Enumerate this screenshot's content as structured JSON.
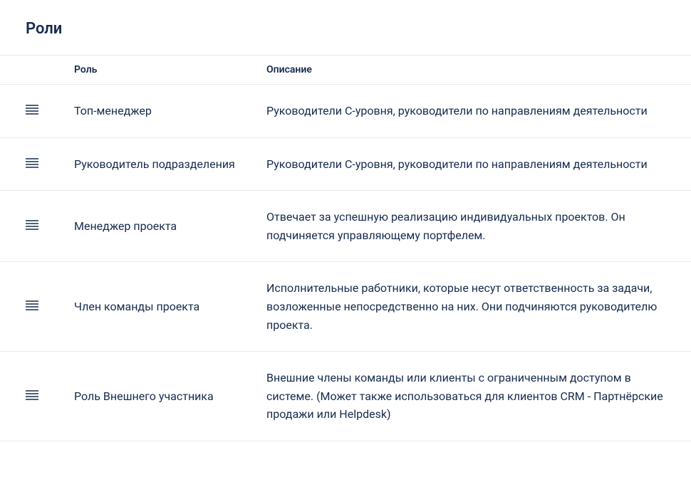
{
  "page": {
    "title": "Роли"
  },
  "table": {
    "headers": {
      "role": "Роль",
      "description": "Описание"
    },
    "rows": [
      {
        "role": "Топ-менеджер",
        "description": "Руководители С-уровня, руководители по направлениям деятельности"
      },
      {
        "role": "Руководитель подразделения",
        "description": "Руководители С-уровня, руководители по направлениям деятельности"
      },
      {
        "role": "Менеджер проекта",
        "description": "Отвечает за успешную реализацию индивидуальных проектов. Он подчиняется управляющему портфелем."
      },
      {
        "role": "Член команды проекта",
        "description": "Исполнительные работники, которые несут ответственность за задачи, возложенные непосредственно на них. Они подчиняются руководителю проекта."
      },
      {
        "role": "Роль Внешнего участника",
        "description": "Внешние члены команды или клиенты с ограниченным доступом в системе. (Может также использоваться для клиентов CRM - Партнёрские продажи или Helpdesk)"
      }
    ]
  }
}
